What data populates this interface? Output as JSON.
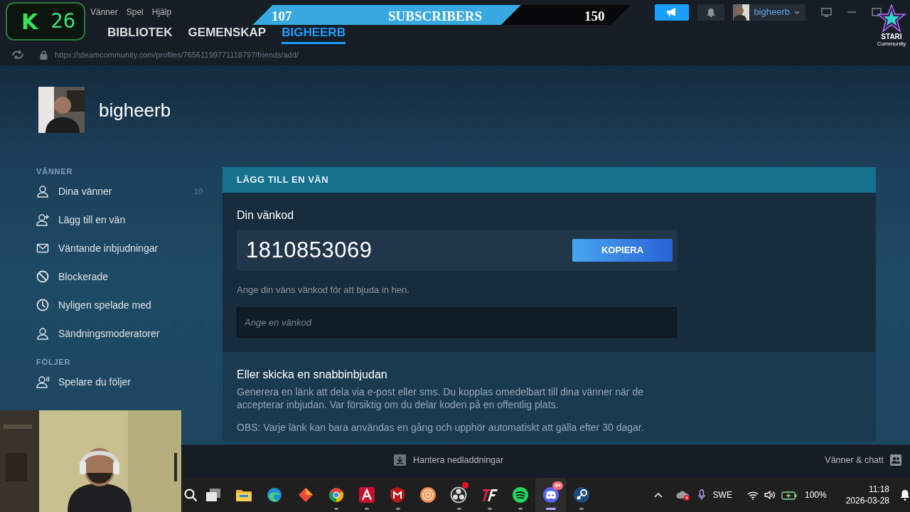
{
  "overlays": {
    "counter_badge": {
      "logo": "K",
      "count": "26"
    },
    "subscriber_goal": {
      "current": "107",
      "label": "SUBSCRIBERS",
      "goal": "150",
      "level": 0.71
    },
    "community_logo": {
      "name": "STARI",
      "tagline": "Community"
    }
  },
  "menu": [
    "Vänner",
    "Spel",
    "Hjälp"
  ],
  "header_buttons": [
    {
      "kind": "announcements",
      "active": true
    },
    {
      "kind": "notifications",
      "active": false
    }
  ],
  "user_menu": {
    "name": "bigheerb"
  },
  "nav_tabs": [
    {
      "label": "BIBLIOTEK",
      "selected": false
    },
    {
      "label": "GEMENSKAP",
      "selected": false
    },
    {
      "label": "BIGHEERB",
      "selected": true
    }
  ],
  "address_bar": {
    "url": "https://steamcommunity.com/profiles/76561199771118797/friends/add/"
  },
  "profile": {
    "name": "bigheerb"
  },
  "sidebar": {
    "sections": [
      {
        "title": "VÄNNER",
        "items": [
          {
            "kind": "person",
            "label": "Dina vänner",
            "count": "10"
          },
          {
            "kind": "person-add",
            "label": "Lägg till en vän"
          },
          {
            "kind": "mail",
            "label": "Väntande inbjudningar"
          },
          {
            "kind": "block",
            "label": "Blockerade"
          },
          {
            "kind": "clock",
            "label": "Nyligen spelade med"
          },
          {
            "kind": "person",
            "label": "Sändningsmoderatorer"
          }
        ]
      },
      {
        "title": "FÖLJER",
        "items": [
          {
            "kind": "person-follow",
            "label": "Spelare du följer"
          }
        ]
      }
    ]
  },
  "panel": {
    "title": "LÄGG TILL EN VÄN",
    "code_label": "Din vänkod",
    "friend_code": "1810853069",
    "copy_button": "KOPIERA",
    "hint": "Ange din väns vänkod för att bjuda in hen.",
    "input": {
      "placeholder": "Ange en vänkod"
    },
    "invite": {
      "title": "Eller skicka en snabbinbjudan",
      "text": "Generera en länk att dela via e-post eller sms. Du kopplas omedelbart till dina vänner när de accepterar inbjudan. Var försiktig om du delar koden på en offentlig plats.",
      "note": "OBS: Varje länk kan bara användas en gång och upphör automatiskt att gälla efter 30 dagar."
    }
  },
  "bottom_bar": {
    "downloads": "Hantera nedladdningar",
    "friends": "Vänner & chatt"
  },
  "taskbar": {
    "apps": [
      {
        "kind": "search",
        "running": false,
        "selected": false,
        "alert": false
      },
      {
        "kind": "taskview",
        "running": false,
        "selected": false,
        "alert": false
      },
      {
        "kind": "folder",
        "running": false,
        "selected": false,
        "alert": false
      },
      {
        "kind": "edge",
        "running": false,
        "selected": false,
        "alert": false
      },
      {
        "kind": "diamond",
        "running": false,
        "selected": false,
        "alert": false
      },
      {
        "kind": "chrome",
        "running": true,
        "selected": false,
        "alert": false
      },
      {
        "kind": "letter-a",
        "running": true,
        "selected": false,
        "alert": false
      },
      {
        "kind": "shield",
        "running": true,
        "selected": false,
        "alert": false
      },
      {
        "kind": "spiral",
        "running": false,
        "selected": false,
        "alert": false
      },
      {
        "kind": "obs",
        "running": true,
        "selected": false,
        "alert": true
      },
      {
        "kind": "tf",
        "running": true,
        "selected": false,
        "alert": false
      },
      {
        "kind": "spotify",
        "running": true,
        "selected": false,
        "alert": false
      },
      {
        "kind": "discord",
        "running": true,
        "selected": true,
        "alert": false,
        "badge": "9+"
      },
      {
        "kind": "steam",
        "running": true,
        "selected": false,
        "alert": false
      }
    ],
    "tray": {
      "language": "SWE",
      "battery": "100%",
      "time": "11:18",
      "date": "2026-03-28"
    }
  }
}
